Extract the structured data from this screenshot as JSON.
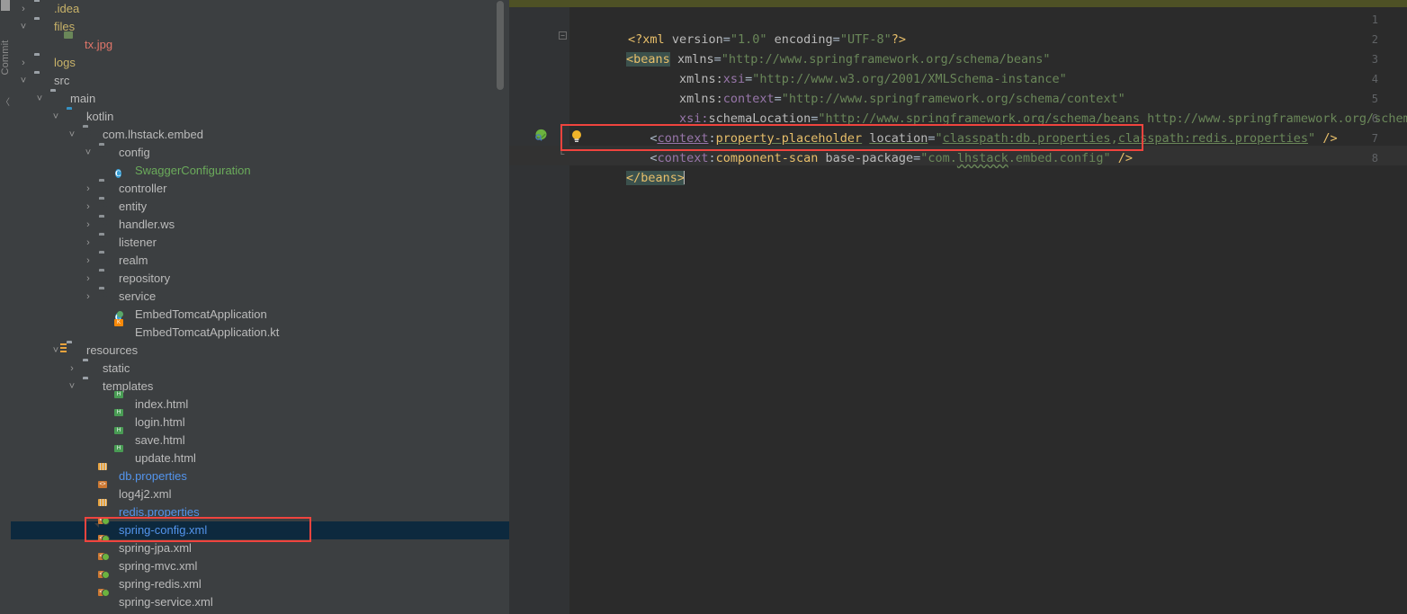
{
  "left_strip": {
    "commit_tab_label": "Commit"
  },
  "project_tree": {
    "items": [
      {
        "label": ".idea",
        "indent": 26,
        "arrow": "›",
        "icon": "folder",
        "color": "c-yellowish"
      },
      {
        "label": "files",
        "indent": 26,
        "arrow": "˅",
        "icon": "folder",
        "color": "c-yellowish"
      },
      {
        "label": "tx.jpg",
        "indent": 60,
        "arrow": "",
        "icon": "file-image",
        "color": "c-salmon"
      },
      {
        "label": "logs",
        "indent": 26,
        "arrow": "›",
        "icon": "folder",
        "color": "c-yellowish"
      },
      {
        "label": "src",
        "indent": 26,
        "arrow": "˅",
        "icon": "folder",
        "color": "c-default"
      },
      {
        "label": "main",
        "indent": 44,
        "arrow": "˅",
        "icon": "folder",
        "color": "c-default"
      },
      {
        "label": "kotlin",
        "indent": 62,
        "arrow": "˅",
        "icon": "folder-blue",
        "color": "c-default"
      },
      {
        "label": "com.lhstack.embed",
        "indent": 80,
        "arrow": "˅",
        "icon": "package",
        "color": "c-default"
      },
      {
        "label": "config",
        "indent": 98,
        "arrow": "˅",
        "icon": "package",
        "color": "c-default"
      },
      {
        "label": "SwaggerConfiguration",
        "indent": 116,
        "arrow": "",
        "icon": "class",
        "color": "c-green"
      },
      {
        "label": "controller",
        "indent": 98,
        "arrow": "›",
        "icon": "package",
        "color": "c-default"
      },
      {
        "label": "entity",
        "indent": 98,
        "arrow": "›",
        "icon": "package",
        "color": "c-default"
      },
      {
        "label": "handler.ws",
        "indent": 98,
        "arrow": "›",
        "icon": "package",
        "color": "c-default"
      },
      {
        "label": "listener",
        "indent": 98,
        "arrow": "›",
        "icon": "package",
        "color": "c-default"
      },
      {
        "label": "realm",
        "indent": 98,
        "arrow": "›",
        "icon": "package",
        "color": "c-default"
      },
      {
        "label": "repository",
        "indent": 98,
        "arrow": "›",
        "icon": "package",
        "color": "c-default"
      },
      {
        "label": "service",
        "indent": 98,
        "arrow": "›",
        "icon": "package",
        "color": "c-default"
      },
      {
        "label": "EmbedTomcatApplication",
        "indent": 116,
        "arrow": "",
        "icon": "class-run",
        "color": "c-default"
      },
      {
        "label": "EmbedTomcatApplication.kt",
        "indent": 116,
        "arrow": "",
        "icon": "file-kt",
        "color": "c-default"
      },
      {
        "label": "resources",
        "indent": 62,
        "arrow": "˅",
        "icon": "resource-root",
        "color": "c-default"
      },
      {
        "label": "static",
        "indent": 80,
        "arrow": "›",
        "icon": "folder",
        "color": "c-default"
      },
      {
        "label": "templates",
        "indent": 80,
        "arrow": "˅",
        "icon": "folder",
        "color": "c-default"
      },
      {
        "label": "index.html",
        "indent": 116,
        "arrow": "",
        "icon": "file-html",
        "color": "c-default"
      },
      {
        "label": "login.html",
        "indent": 116,
        "arrow": "",
        "icon": "file-html",
        "color": "c-default"
      },
      {
        "label": "save.html",
        "indent": 116,
        "arrow": "",
        "icon": "file-html",
        "color": "c-default"
      },
      {
        "label": "update.html",
        "indent": 116,
        "arrow": "",
        "icon": "file-html",
        "color": "c-default"
      },
      {
        "label": "db.properties",
        "indent": 98,
        "arrow": "",
        "icon": "file-prop",
        "color": "c-blue"
      },
      {
        "label": "log4j2.xml",
        "indent": 98,
        "arrow": "",
        "icon": "file-xml",
        "color": "c-default"
      },
      {
        "label": "redis.properties",
        "indent": 98,
        "arrow": "",
        "icon": "file-prop",
        "color": "c-blue"
      },
      {
        "label": "spring-config.xml",
        "indent": 98,
        "arrow": "",
        "icon": "file-springxml",
        "color": "c-blue",
        "selected": true
      },
      {
        "label": "spring-jpa.xml",
        "indent": 98,
        "arrow": "",
        "icon": "file-springxml",
        "color": "c-default"
      },
      {
        "label": "spring-mvc.xml",
        "indent": 98,
        "arrow": "",
        "icon": "file-springxml",
        "color": "c-default"
      },
      {
        "label": "spring-redis.xml",
        "indent": 98,
        "arrow": "",
        "icon": "file-springxml",
        "color": "c-default"
      },
      {
        "label": "spring-service.xml",
        "indent": 98,
        "arrow": "",
        "icon": "file-springxml",
        "color": "c-default"
      }
    ],
    "selected_item": "spring-config.xml"
  },
  "annotations": {
    "tree_highlight_target": "spring-config.xml",
    "code_highlight_target": "<context:component-scan base-package=\"com.lhstack.embed.config\" />",
    "box_color": "#f0443e"
  },
  "editor": {
    "gutter_numbers": [
      "1",
      "2",
      "3",
      "4",
      "5",
      "6",
      "7",
      "8"
    ],
    "lines": [
      {
        "n": 1,
        "text": "<?xml version=\"1.0\" encoding=\"UTF-8\"?>"
      },
      {
        "n": 2,
        "text": "<beans xmlns=\"http://www.springframework.org/schema/beans\""
      },
      {
        "n": 3,
        "text": "       xmlns:xsi=\"http://www.w3.org/2001/XMLSchema-instance\""
      },
      {
        "n": 4,
        "text": "       xmlns:context=\"http://www.springframework.org/schema/context\""
      },
      {
        "n": 5,
        "text": "       xsi:schemaLocation=\"http://www.springframework.org/schema/beans http://www.springframework.org/schema/beans/spr"
      },
      {
        "n": 6,
        "text": "    <context:property-placeholder location=\"classpath:db.properties,classpath:redis.properties\" />"
      },
      {
        "n": 7,
        "text": "    <context:component-scan base-package=\"com.lhstack.embed.config\" />"
      },
      {
        "n": 8,
        "text": "</beans>"
      }
    ],
    "tokens": {
      "line1": {
        "decl_open": "<?xml",
        "attr_version": "version",
        "val_version": "\"1.0\"",
        "attr_encoding": "encoding",
        "val_encoding": "\"UTF-8\"",
        "decl_close": "?>"
      },
      "line2": {
        "tag": "<beans",
        "attr": "xmlns",
        "value": "\"http://www.springframework.org/schema/beans\""
      },
      "line3": {
        "attr_prefix": "xmlns:",
        "attr_local": "xsi",
        "value": "\"http://www.w3.org/2001/XMLSchema-instance\""
      },
      "line4": {
        "attr_prefix": "xmlns:",
        "attr_local": "context",
        "value": "\"http://www.springframework.org/schema/context\""
      },
      "line5": {
        "attr_prefix": "xsi:",
        "attr_local": "schemaLocation",
        "value": "\"http://www.springframework.org/schema/beans http://www.springframework.org/schema/beans/spr"
      },
      "line6": {
        "open": "<",
        "ns": "context",
        "colon": ":",
        "tag": "property-placeholder",
        "attr": "location",
        "val_open": "\"",
        "val_a": "classpath:db.properties",
        "val_comma": ",",
        "val_b": "classpath:redis.properties",
        "val_close": "\"",
        "selfclose": "/>"
      },
      "line7": {
        "open": "<",
        "ns": "context",
        "colon": ":",
        "tag": "component-scan",
        "attr": "base-package",
        "val_open": "\"com.",
        "val_squiggle": "lhstack",
        "val_rest": ".embed.config\"",
        "selfclose": "/>"
      },
      "line8": {
        "tag": "</beans>"
      }
    },
    "gutter_icons": {
      "spring_bean_line": "7",
      "spring_bean_icon": "spring-bean-icon",
      "intention_bulb_line": "7",
      "intention_bulb_icon": "lightbulb-icon",
      "fold_lines": [
        "2",
        "8"
      ]
    }
  }
}
